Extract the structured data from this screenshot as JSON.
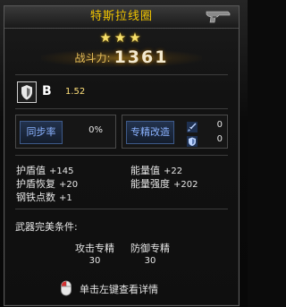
{
  "window": {
    "title": "特斯拉线圈",
    "stars": "★★★",
    "power_label": "战斗力:",
    "power_value": "1361"
  },
  "grade": {
    "letter": "B",
    "value": "1.52"
  },
  "skills": {
    "sync_label": "同步率",
    "sync_value": "0%",
    "mod_label": "专精改造",
    "attack_mod_value": "0",
    "defense_mod_value": "0"
  },
  "stats": {
    "shield_label": "护盾值",
    "shield_value": "+145",
    "energy_label": "能量值",
    "energy_value": "+22",
    "shield_regen_label": "护盾恢复",
    "shield_regen_value": "+20",
    "energy_strength_label": "能量强度",
    "energy_strength_value": "+202",
    "iron_points_label": "钢铁点数",
    "iron_points_value": "+1"
  },
  "perfect": {
    "title": "武器完美条件:",
    "req1_label": "攻击专精",
    "req1_value": "30",
    "req2_label": "防御专精",
    "req2_value": "30"
  },
  "hint": {
    "text": "单击左键查看详情"
  },
  "colors": {
    "title": "#f0c400",
    "stars": "#f6df6b",
    "skill_label": "#8ab2ff",
    "grade_value": "#ffe07a"
  },
  "icons": {
    "title": "pistol-icon",
    "grade": "shield-icon",
    "attack_mod": "sword-icon",
    "defense_mod": "shield-icon",
    "hint": "mouse-left-click-icon"
  }
}
